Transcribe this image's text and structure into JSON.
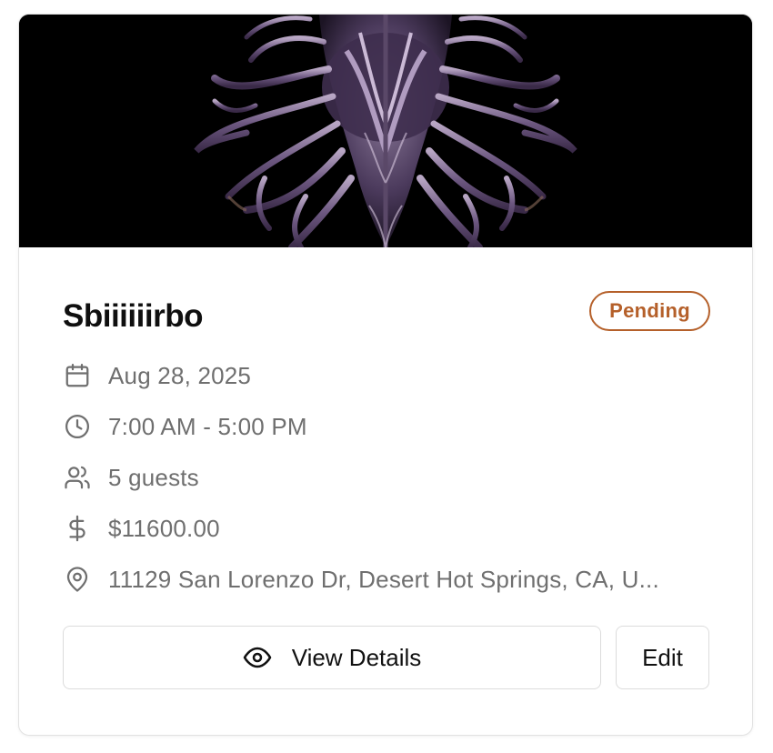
{
  "event": {
    "name": "Sbiiiiiirbo",
    "status": "Pending",
    "status_color": "#b5602a",
    "date": "Aug 28, 2025",
    "time": "7:00 AM - 5:00 PM",
    "guests": "5 guests",
    "price": "$11600.00",
    "address": "11129 San Lorenzo Dr, Desert Hot Springs, CA, U..."
  },
  "icons": {
    "date": "calendar-icon",
    "time": "clock-icon",
    "guests": "users-icon",
    "price": "dollar-icon",
    "address": "map-pin-icon",
    "view": "eye-icon"
  },
  "actions": {
    "view_label": "View Details",
    "edit_label": "Edit"
  }
}
